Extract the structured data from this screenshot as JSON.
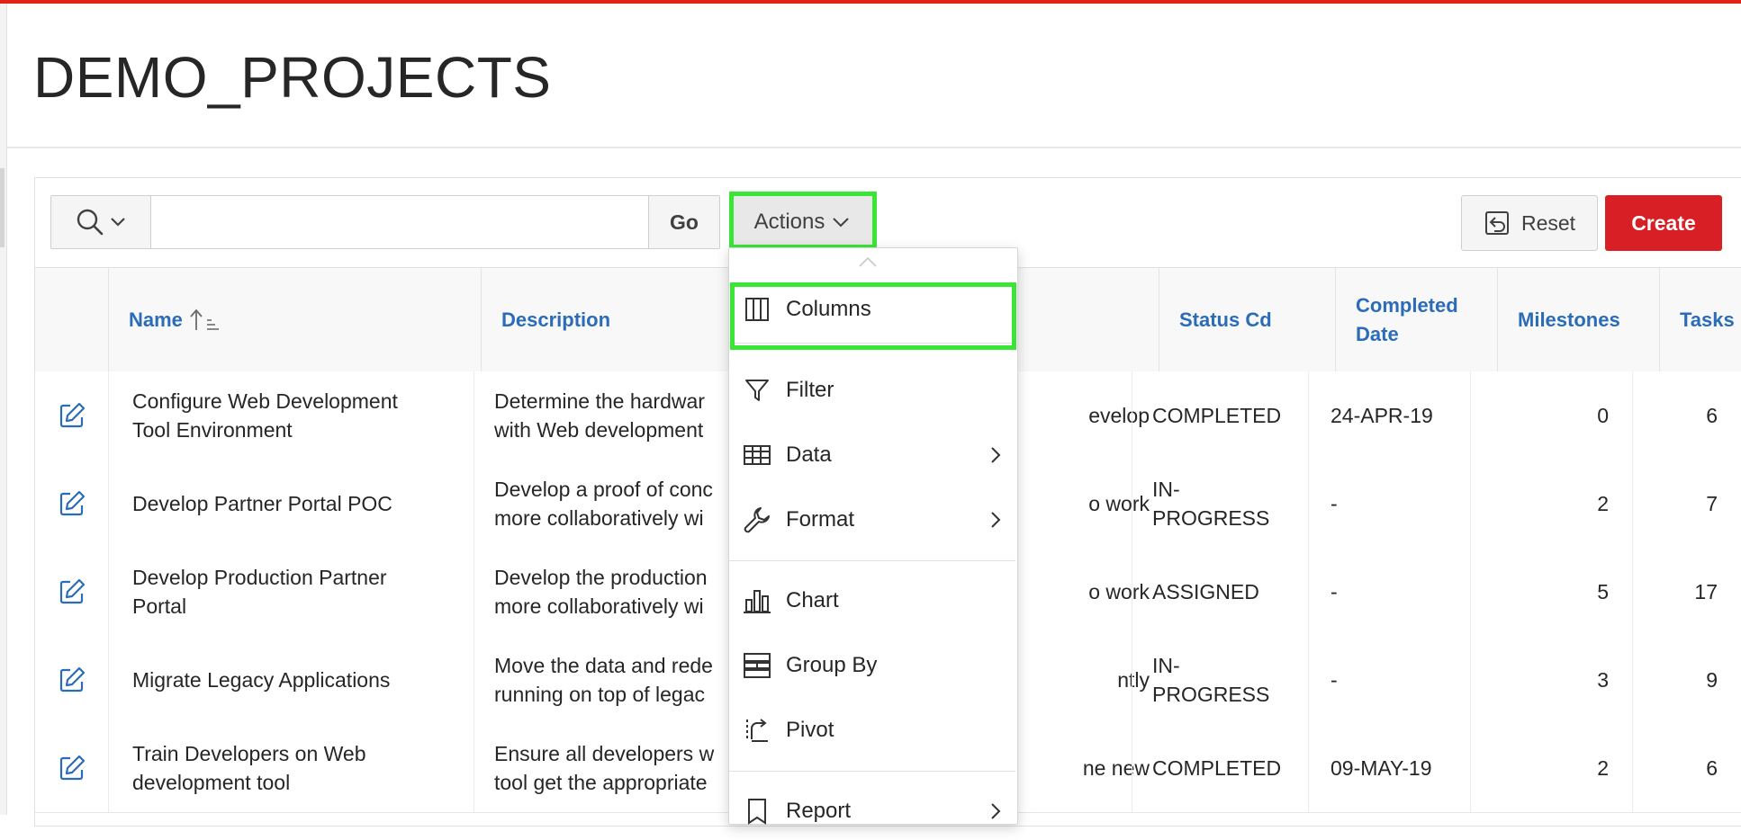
{
  "page": {
    "title": "DEMO_PROJECTS"
  },
  "toolbar": {
    "search_placeholder": "",
    "go_label": "Go",
    "actions_label": "Actions",
    "reset_label": "Reset",
    "create_label": "Create"
  },
  "table": {
    "columns": [
      "Name",
      "Description",
      "Status Cd",
      "Completed Date",
      "Milestones",
      "Tasks"
    ],
    "completed_date_lines": [
      "Completed",
      "Date"
    ],
    "rows": [
      {
        "name_lines": [
          "Configure Web Development",
          "Tool Environment"
        ],
        "desc_left": [
          "Determine the hardwar",
          "with Web development"
        ],
        "desc_right": [
          "evelop",
          ""
        ],
        "status_lines": [
          "COMPLETED"
        ],
        "completed": "24-APR-19",
        "milestones": "0",
        "tasks": "6"
      },
      {
        "name_lines": [
          "Develop Partner Portal POC"
        ],
        "desc_left": [
          "Develop a proof of conc",
          "more collaboratively wi"
        ],
        "desc_right": [
          "o work",
          ""
        ],
        "status_lines": [
          "IN-",
          "PROGRESS"
        ],
        "completed": "-",
        "milestones": "2",
        "tasks": "7"
      },
      {
        "name_lines": [
          "Develop Production Partner",
          "Portal"
        ],
        "desc_left": [
          "Develop the production",
          "more collaboratively wi"
        ],
        "desc_right": [
          "o work",
          ""
        ],
        "status_lines": [
          "ASSIGNED"
        ],
        "completed": "-",
        "milestones": "5",
        "tasks": "17"
      },
      {
        "name_lines": [
          "Migrate Legacy Applications"
        ],
        "desc_left": [
          "Move the data and rede",
          "running on top of legac"
        ],
        "desc_right": [
          "ntly",
          ""
        ],
        "status_lines": [
          "IN-",
          "PROGRESS"
        ],
        "completed": "-",
        "milestones": "3",
        "tasks": "9"
      },
      {
        "name_lines": [
          "Train Developers on Web",
          "development tool"
        ],
        "desc_left": [
          "Ensure all developers w",
          "tool get the appropriate"
        ],
        "desc_right": [
          "ne new",
          ""
        ],
        "status_lines": [
          "COMPLETED"
        ],
        "completed": "09-MAY-19",
        "milestones": "2",
        "tasks": "6"
      }
    ]
  },
  "actions_menu": {
    "items": [
      {
        "label": "Columns",
        "icon": "columns-icon",
        "submenu": false
      },
      {
        "label": "Filter",
        "icon": "filter-icon",
        "submenu": false
      },
      {
        "label": "Data",
        "icon": "data-table-icon",
        "submenu": true
      },
      {
        "label": "Format",
        "icon": "wrench-icon",
        "submenu": true
      },
      {
        "label": "Chart",
        "icon": "bar-chart-icon",
        "submenu": false
      },
      {
        "label": "Group By",
        "icon": "group-by-icon",
        "submenu": false
      },
      {
        "label": "Pivot",
        "icon": "pivot-icon",
        "submenu": false
      },
      {
        "label": "Report",
        "icon": "report-icon",
        "submenu": true
      }
    ]
  },
  "colors": {
    "accent_red": "#d81f26",
    "link_blue": "#2b6cb8",
    "highlight_green": "#39e636"
  }
}
